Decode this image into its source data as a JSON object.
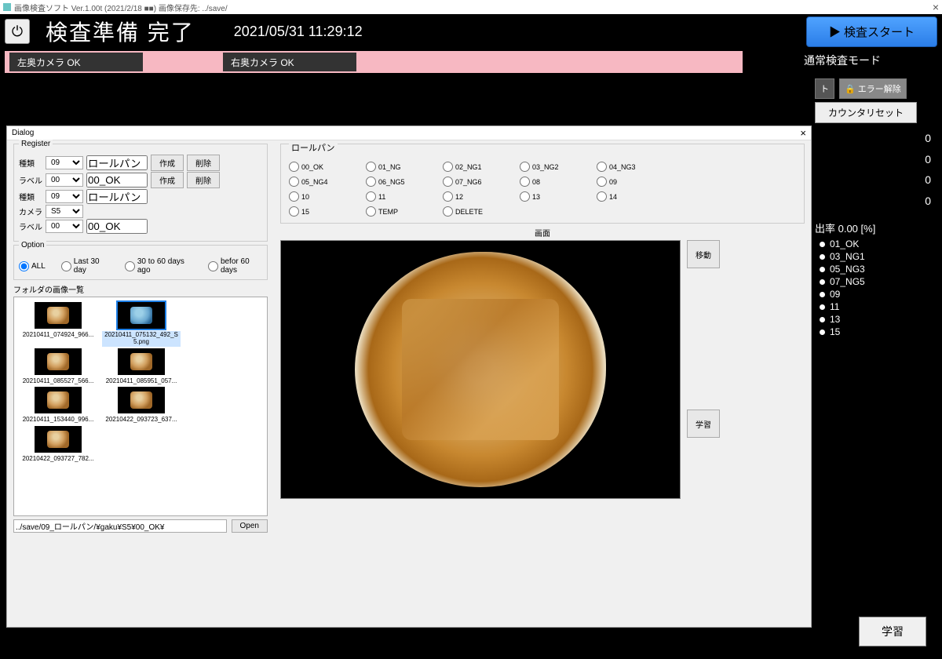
{
  "titlebar": {
    "text": "画像検査ソフト Ver.1.00t (2021/2/18 ■■) 画像保存先: ../save/"
  },
  "header": {
    "title": "検査準備 完了",
    "timestamp": "2021/05/31 11:29:12",
    "start_btn": "▶ 検査スタート",
    "mode": "通常検査モード"
  },
  "cameras": {
    "left": "左奥カメラ OK",
    "right": "右奥カメラ OK"
  },
  "right_panel": {
    "btn_truncated": "ト",
    "error_clear": "🔒 エラー解除",
    "counter_reset": "カウンタリセット",
    "zeros": [
      "0",
      "0",
      "0",
      "0"
    ],
    "rate": "出率 0.00 [%]",
    "legend": [
      "01_OK",
      "03_NG1",
      "05_NG3",
      "07_NG5",
      "09",
      "11",
      "13",
      "15"
    ],
    "learn_btn": "学習"
  },
  "dialog": {
    "title": "Dialog",
    "register": {
      "legend": "Register",
      "lbl_type": "種類",
      "lbl_label": "ラベル",
      "lbl_camera": "カメラ",
      "type_val": "09",
      "type_text": "ロールパン",
      "label_val": "00",
      "label_text": "00_OK",
      "camera_val": "S5",
      "make": "作成",
      "del": "削除"
    },
    "option": {
      "legend": "Option",
      "all": "ALL",
      "last30": "Last 30 day",
      "mid": "30 to 60 days ago",
      "befor": "befor 60 days"
    },
    "folder_title": "フォルダの画像一覧",
    "thumbs": [
      {
        "name": "20210411_074924_966..."
      },
      {
        "name": "20210411_075132_492_S5.png",
        "selected": true,
        "blue": true
      },
      {
        "name": "20210411_085527_566..."
      },
      {
        "name": "20210411_085951_057..."
      },
      {
        "name": "20210411_153440_996..."
      },
      {
        "name": "20210422_093723_637..."
      },
      {
        "name": "20210422_093727_782..."
      }
    ],
    "path": "../save/09_ロールパン/¥gaku¥S5¥00_OK¥",
    "open": "Open",
    "roll_panel": {
      "legend": "ロールパン",
      "items": [
        "00_OK",
        "01_NG",
        "02_NG1",
        "03_NG2",
        "04_NG3",
        "05_NG4",
        "06_NG5",
        "07_NG6",
        "08",
        "09",
        "10",
        "11",
        "12",
        "13",
        "14",
        "15",
        "TEMP",
        "DELETE"
      ]
    },
    "screen": "画面",
    "move": "移動",
    "learn": "学習"
  }
}
